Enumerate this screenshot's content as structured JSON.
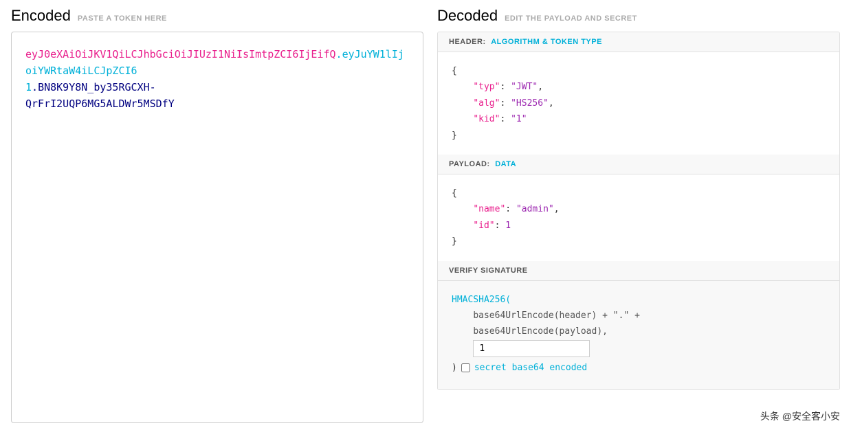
{
  "left": {
    "title": "Encoded",
    "subtitle": "PASTE A TOKEN HERE",
    "token": {
      "part1": "eyJ0eXAiOiJKV1QiLCJhbGciOiJIUzI1NiIsImt",
      "dot1": ".",
      "part1b": "pZCI6IjEifQ",
      "dot2": ".",
      "part2": "eyJuYW1lIjoiYWRtaW4iLCJpZCI6",
      "part2b": "1",
      "dot3": ".",
      "part3": "BN8K9Y8N_by35RGCXH-QrFrI2UQP6MG5ALDWr5MSDfY"
    }
  },
  "right": {
    "title": "Decoded",
    "subtitle": "EDIT THE PAYLOAD AND SECRET",
    "header_section": {
      "label": "HEADER:",
      "sublabel": "ALGORITHM & TOKEN TYPE",
      "json": {
        "typ": "JWT",
        "alg": "HS256",
        "kid": "1"
      }
    },
    "payload_section": {
      "label": "PAYLOAD:",
      "sublabel": "DATA",
      "json": {
        "name": "admin",
        "id": 1
      }
    },
    "verify_section": {
      "label": "VERIFY SIGNATURE",
      "fn_name": "HMACSHA256(",
      "line1": "base64UrlEncode(header) + \".\" +",
      "line2": "base64UrlEncode(payload),",
      "secret_value": "1",
      "close": ")",
      "checkbox_label": "secret base64 encoded"
    }
  },
  "watermark": "头条 @安全客小安"
}
